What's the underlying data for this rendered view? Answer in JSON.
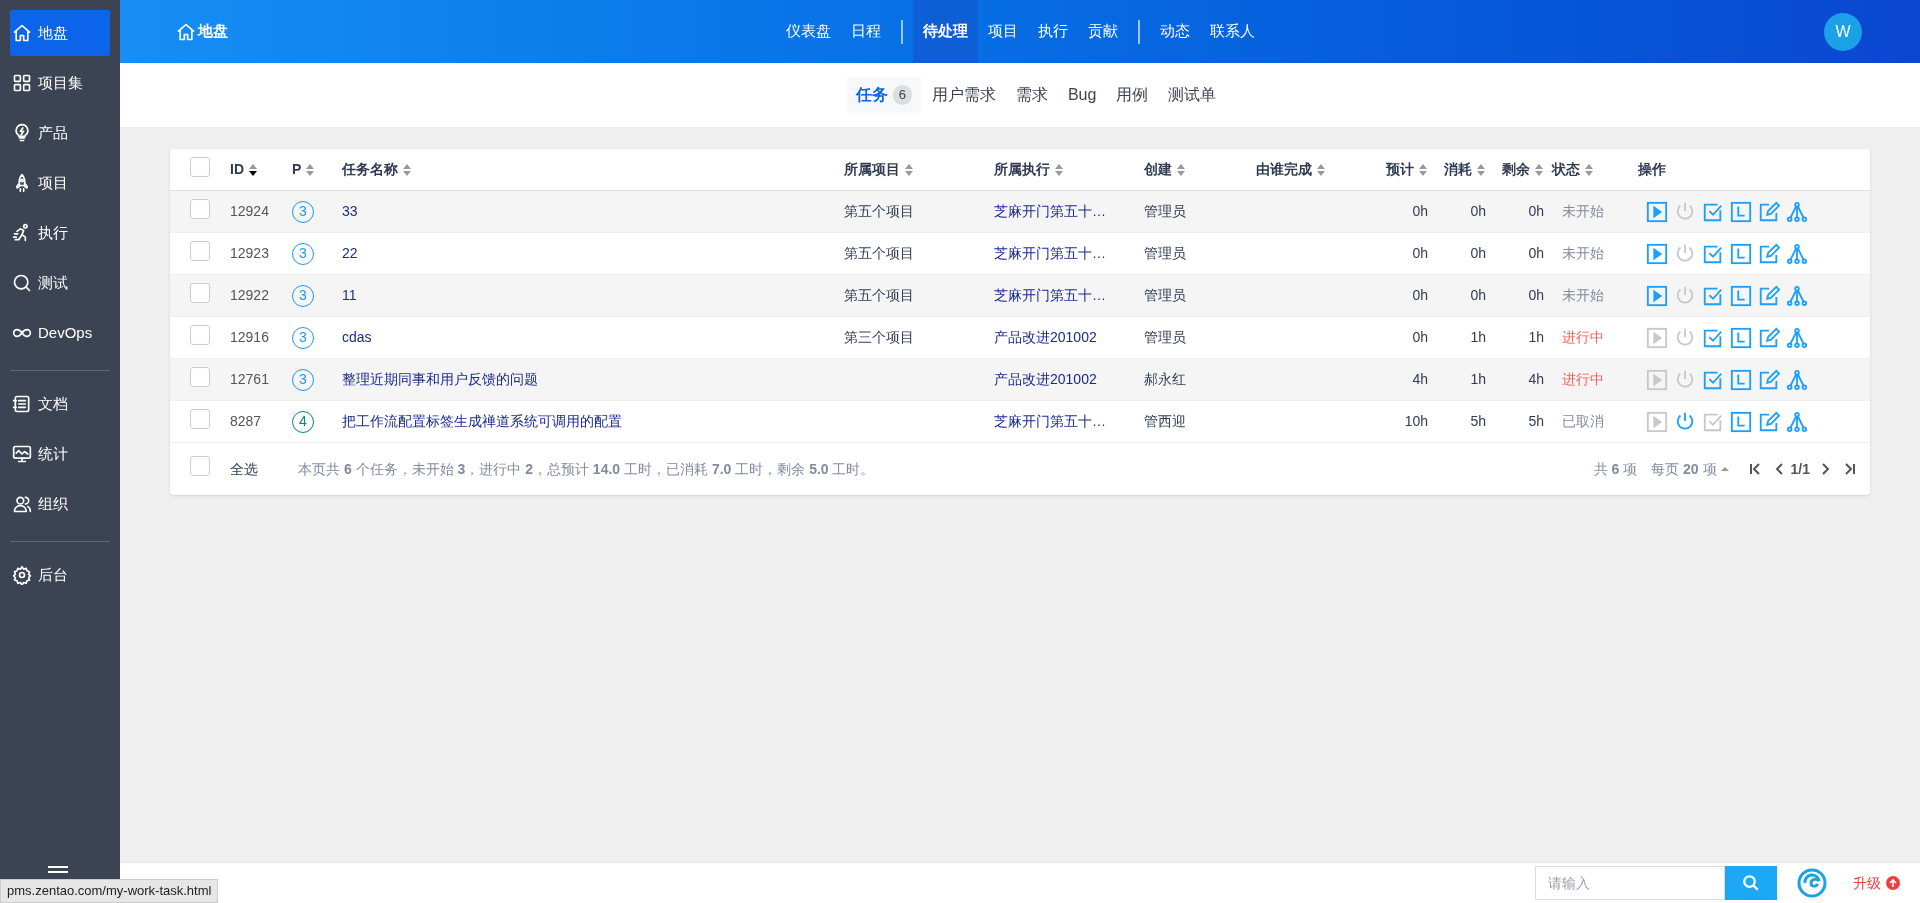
{
  "sidebar": {
    "items": [
      {
        "label": "地盘",
        "selected": true
      },
      {
        "label": "项目集",
        "selected": false
      },
      {
        "label": "产品",
        "selected": false
      },
      {
        "label": "项目",
        "selected": false
      },
      {
        "label": "执行",
        "selected": false
      },
      {
        "label": "测试",
        "selected": false
      },
      {
        "label": "DevOps",
        "selected": false
      },
      {
        "kind": "divider"
      },
      {
        "label": "文档",
        "selected": false
      },
      {
        "label": "统计",
        "selected": false
      },
      {
        "label": "组织",
        "selected": false
      },
      {
        "kind": "divider"
      },
      {
        "label": "后台",
        "selected": false
      }
    ]
  },
  "top_bar": {
    "title": "地盘",
    "nav": [
      {
        "label": "仪表盘",
        "selected": false
      },
      {
        "label": "日程",
        "selected": false
      },
      {
        "kind": "divider"
      },
      {
        "label": "待处理",
        "selected": true
      },
      {
        "label": "项目",
        "selected": false
      },
      {
        "label": "执行",
        "selected": false
      },
      {
        "label": "贡献",
        "selected": false
      },
      {
        "kind": "divider"
      },
      {
        "label": "动态",
        "selected": false
      },
      {
        "label": "联系人",
        "selected": false
      }
    ],
    "avatar": "W"
  },
  "sub_tabs": [
    {
      "label": "任务",
      "count": "6",
      "selected": true
    },
    {
      "label": "用户需求",
      "selected": false
    },
    {
      "label": "需求",
      "selected": false
    },
    {
      "label": "Bug",
      "selected": false
    },
    {
      "label": "用例",
      "selected": false
    },
    {
      "label": "测试单",
      "selected": false
    }
  ],
  "table": {
    "header_checked": false,
    "columns": [
      {
        "label": "ID",
        "sorted": true
      },
      {
        "label": "P",
        "sorted": false
      },
      {
        "label": "任务名称",
        "sorted": false
      },
      {
        "label": "所属项目",
        "sorted": false
      },
      {
        "label": "所属执行",
        "sorted": false
      },
      {
        "label": "创建",
        "sorted": false
      },
      {
        "label": "由谁完成",
        "sorted": false
      },
      {
        "label": "预计",
        "sorted": false
      },
      {
        "label": "消耗",
        "sorted": false
      },
      {
        "label": "剩余",
        "sorted": false
      },
      {
        "label": "状态",
        "sorted": false
      },
      {
        "label": "操作"
      }
    ],
    "rows": [
      {
        "id": "12924",
        "priority": {
          "label": "3",
          "color": "#2196f3"
        },
        "name": "33",
        "project": "第五个项目",
        "execution": "芝麻开门第五十…",
        "creator": "管理员",
        "estimate": "0h",
        "consumed": "0h",
        "left": "0h",
        "status": {
          "label": "未开始",
          "color": "#838a9d"
        },
        "checked": false,
        "actions": [
          {
            "kind": "start",
            "disabled": false
          },
          {
            "kind": "close",
            "disabled": true
          },
          {
            "kind": "finish",
            "disabled": false
          },
          {
            "kind": "log",
            "disabled": false
          },
          {
            "kind": "edit",
            "disabled": false
          },
          {
            "kind": "split",
            "disabled": false
          }
        ]
      },
      {
        "id": "12923",
        "priority": {
          "label": "3",
          "color": "#2196f3"
        },
        "name": "22",
        "project": "第五个项目",
        "execution": "芝麻开门第五十…",
        "creator": "管理员",
        "estimate": "0h",
        "consumed": "0h",
        "left": "0h",
        "status": {
          "label": "未开始",
          "color": "#838a9d"
        },
        "checked": false,
        "actions": [
          {
            "kind": "start",
            "disabled": false
          },
          {
            "kind": "close",
            "disabled": true
          },
          {
            "kind": "finish",
            "disabled": false
          },
          {
            "kind": "log",
            "disabled": false
          },
          {
            "kind": "edit",
            "disabled": false
          },
          {
            "kind": "split",
            "disabled": false
          }
        ]
      },
      {
        "id": "12922",
        "priority": {
          "label": "3",
          "color": "#2196f3"
        },
        "name": "11",
        "project": "第五个项目",
        "execution": "芝麻开门第五十…",
        "creator": "管理员",
        "estimate": "0h",
        "consumed": "0h",
        "left": "0h",
        "status": {
          "label": "未开始",
          "color": "#838a9d"
        },
        "checked": false,
        "actions": [
          {
            "kind": "start",
            "disabled": false
          },
          {
            "kind": "close",
            "disabled": true
          },
          {
            "kind": "finish",
            "disabled": false
          },
          {
            "kind": "log",
            "disabled": false
          },
          {
            "kind": "edit",
            "disabled": false
          },
          {
            "kind": "split",
            "disabled": false
          }
        ]
      },
      {
        "id": "12916",
        "priority": {
          "label": "3",
          "color": "#2196f3"
        },
        "name": "cdas",
        "project": "第三个项目",
        "execution": "产品改进201002",
        "creator": "管理员",
        "estimate": "0h",
        "consumed": "1h",
        "left": "1h",
        "status": {
          "label": "进行中",
          "color": "#ff5d5d"
        },
        "checked": false,
        "actions": [
          {
            "kind": "start",
            "disabled": true
          },
          {
            "kind": "close",
            "disabled": true
          },
          {
            "kind": "finish",
            "disabled": false
          },
          {
            "kind": "log",
            "disabled": false
          },
          {
            "kind": "edit",
            "disabled": false
          },
          {
            "kind": "split",
            "disabled": false
          }
        ]
      },
      {
        "id": "12761",
        "priority": {
          "label": "3",
          "color": "#2196f3"
        },
        "name": "整理近期同事和用户反馈的问题",
        "execution": "产品改进201002",
        "creator": "郝永红",
        "estimate": "4h",
        "consumed": "1h",
        "left": "4h",
        "status": {
          "label": "进行中",
          "color": "#ff5d5d"
        },
        "checked": false,
        "actions": [
          {
            "kind": "start",
            "disabled": true
          },
          {
            "kind": "close",
            "disabled": true
          },
          {
            "kind": "finish",
            "disabled": false
          },
          {
            "kind": "log",
            "disabled": false
          },
          {
            "kind": "edit",
            "disabled": false
          },
          {
            "kind": "split",
            "disabled": false
          }
        ]
      },
      {
        "id": "8287",
        "priority": {
          "label": "4",
          "color": "#00897b"
        },
        "name": "把工作流配置标签生成禅道系统可调用的配置",
        "execution": "芝麻开门第五十…",
        "creator": "管西迎",
        "estimate": "10h",
        "consumed": "5h",
        "left": "5h",
        "status": {
          "label": "已取消",
          "color": "#838a9d"
        },
        "checked": false,
        "actions": [
          {
            "kind": "start",
            "disabled": true
          },
          {
            "kind": "close",
            "disabled": false
          },
          {
            "kind": "finish",
            "disabled": true
          },
          {
            "kind": "log",
            "disabled": false
          },
          {
            "kind": "edit",
            "disabled": false
          },
          {
            "kind": "split",
            "disabled": false
          }
        ]
      }
    ]
  },
  "table_footer": {
    "select_all": {
      "label": "全选",
      "checked": false
    },
    "summary": "本页共 **6** 个任务，未开始 **3**，进行中 **2**，总预计 **14.0** 工时，已消耗 **7.0** 工时，剩余 **5.0** 工时。",
    "total": "共 **6** 项",
    "per_page": "每页 **20** 项",
    "page": "1/1"
  },
  "bottom_bar": {
    "search": {
      "placeholder": "请输入"
    },
    "upgrade": "升级"
  },
  "status_url": "pms.zentao.com/my-work-task.html"
}
